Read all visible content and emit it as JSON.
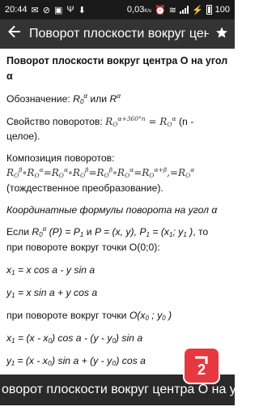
{
  "status": {
    "time": "20:44",
    "speed": "0,03",
    "speed_unit": "K/s",
    "battery": "100"
  },
  "appbar": {
    "back_icon": "arrow-left-icon",
    "title": "Поворот плоскости вокруг центра",
    "star_icon": "star-icon"
  },
  "content": {
    "heading": "Поворот плоскости вокруг центра O на угол α",
    "notation_label": "Обозначение:",
    "notation_or": "или",
    "property_label": "Свойство поворотов:",
    "property_note": "(n - целое).",
    "composition_label": "Композиция поворотов:",
    "composition_note": "(тождественное преобразование).",
    "coord_heading": "Координатные формулы поворота на угол α",
    "if_text": "Если",
    "then_text": ", то",
    "rotation_origin": "при повороте вокруг точки O(0;0):",
    "formula_x1": "x",
    "formula_x1_rhs": "= x cos a - y sin a",
    "formula_y1": "y",
    "formula_y1_rhs": "= x sin a + y cos a",
    "rotation_point": "при повороте вокруг точки",
    "formula_x1b_rhs": "= (x - x",
    "formula_x1b_mid": ") cos a - (y - y",
    "formula_x1b_end": ") sin a",
    "formula_y1b_partial": "y₁ = (x - x₀) sin a + (y - y₀) cos a"
  },
  "footer": {
    "text": "оворот плоскости вокруг центра O на угол a"
  }
}
